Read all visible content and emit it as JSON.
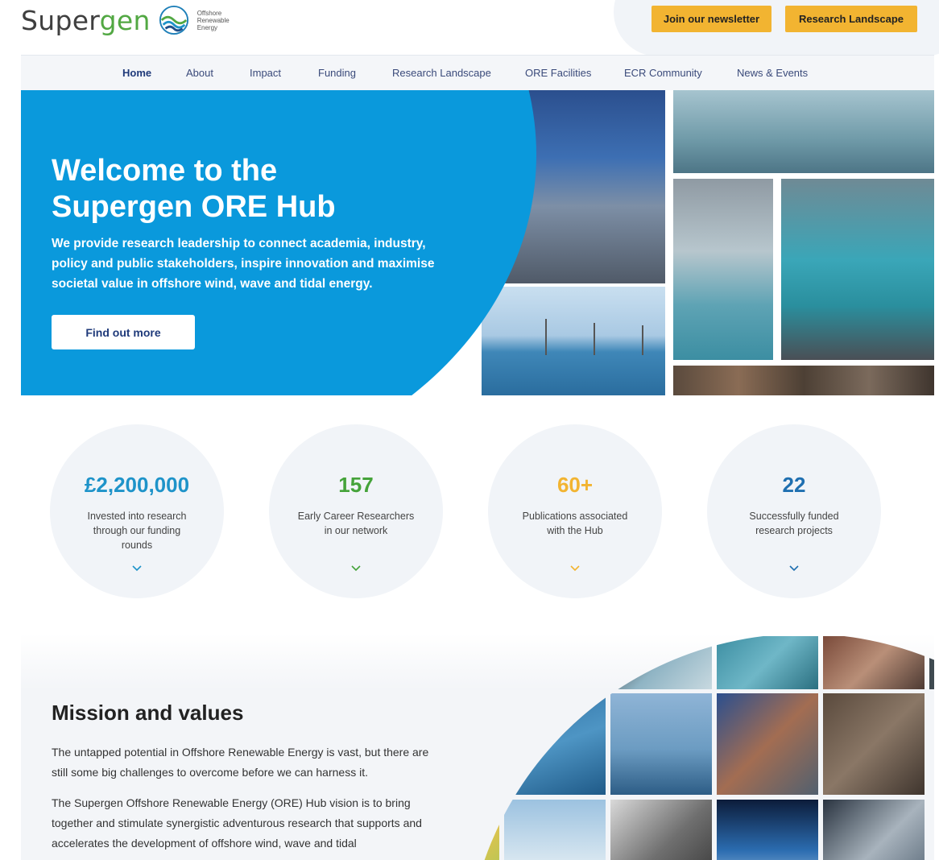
{
  "header": {
    "logo_word_a": "Super",
    "logo_word_b": "gen",
    "logo_subtitle_1": "Offshore",
    "logo_subtitle_2": "Renewable",
    "logo_subtitle_3": "Energy",
    "newsletter_button": "Join our newsletter",
    "landscape_button": "Research Landscape"
  },
  "nav": {
    "items": [
      "Home",
      "About",
      "Impact",
      "Funding",
      "Research Landscape",
      "ORE Facilities",
      "ECR Community",
      "News & Events"
    ],
    "active": "Home"
  },
  "hero": {
    "title_line1": "Welcome to the",
    "title_line2": "Supergen ORE Hub",
    "description": "We provide research leadership to connect academia, industry, policy and public stakeholders, inspire innovation and maximise societal value in offshore wind, wave and tidal energy.",
    "cta": "Find out more"
  },
  "stats": [
    {
      "value": "£2,200,000",
      "description": "Invested into research through our funding rounds",
      "color": "#1e93c9"
    },
    {
      "value": "157",
      "description": "Early Career Researchers in our network",
      "color": "#45a33a"
    },
    {
      "value": "60+",
      "description": "Publications associated with the Hub",
      "color": "#f2b431"
    },
    {
      "value": "22",
      "description": "Successfully funded research projects",
      "color": "#1f6fb0"
    }
  ],
  "mission": {
    "title": "Mission and values",
    "para1": "The untapped potential in Offshore Renewable Energy is vast, but there are still some big challenges to overcome before we can harness it.",
    "para2": "The Supergen Offshore Renewable Energy (ORE) Hub vision is to bring together and stimulate synergistic adventurous research that supports and accelerates the development of offshore wind, wave and tidal"
  },
  "colors": {
    "accent_blue": "#0a99dc",
    "button_yellow": "#f2b431",
    "nav_text": "#3a4a7a"
  },
  "icons": [
    "logo-wave-icon",
    "chevron-down-icon"
  ]
}
